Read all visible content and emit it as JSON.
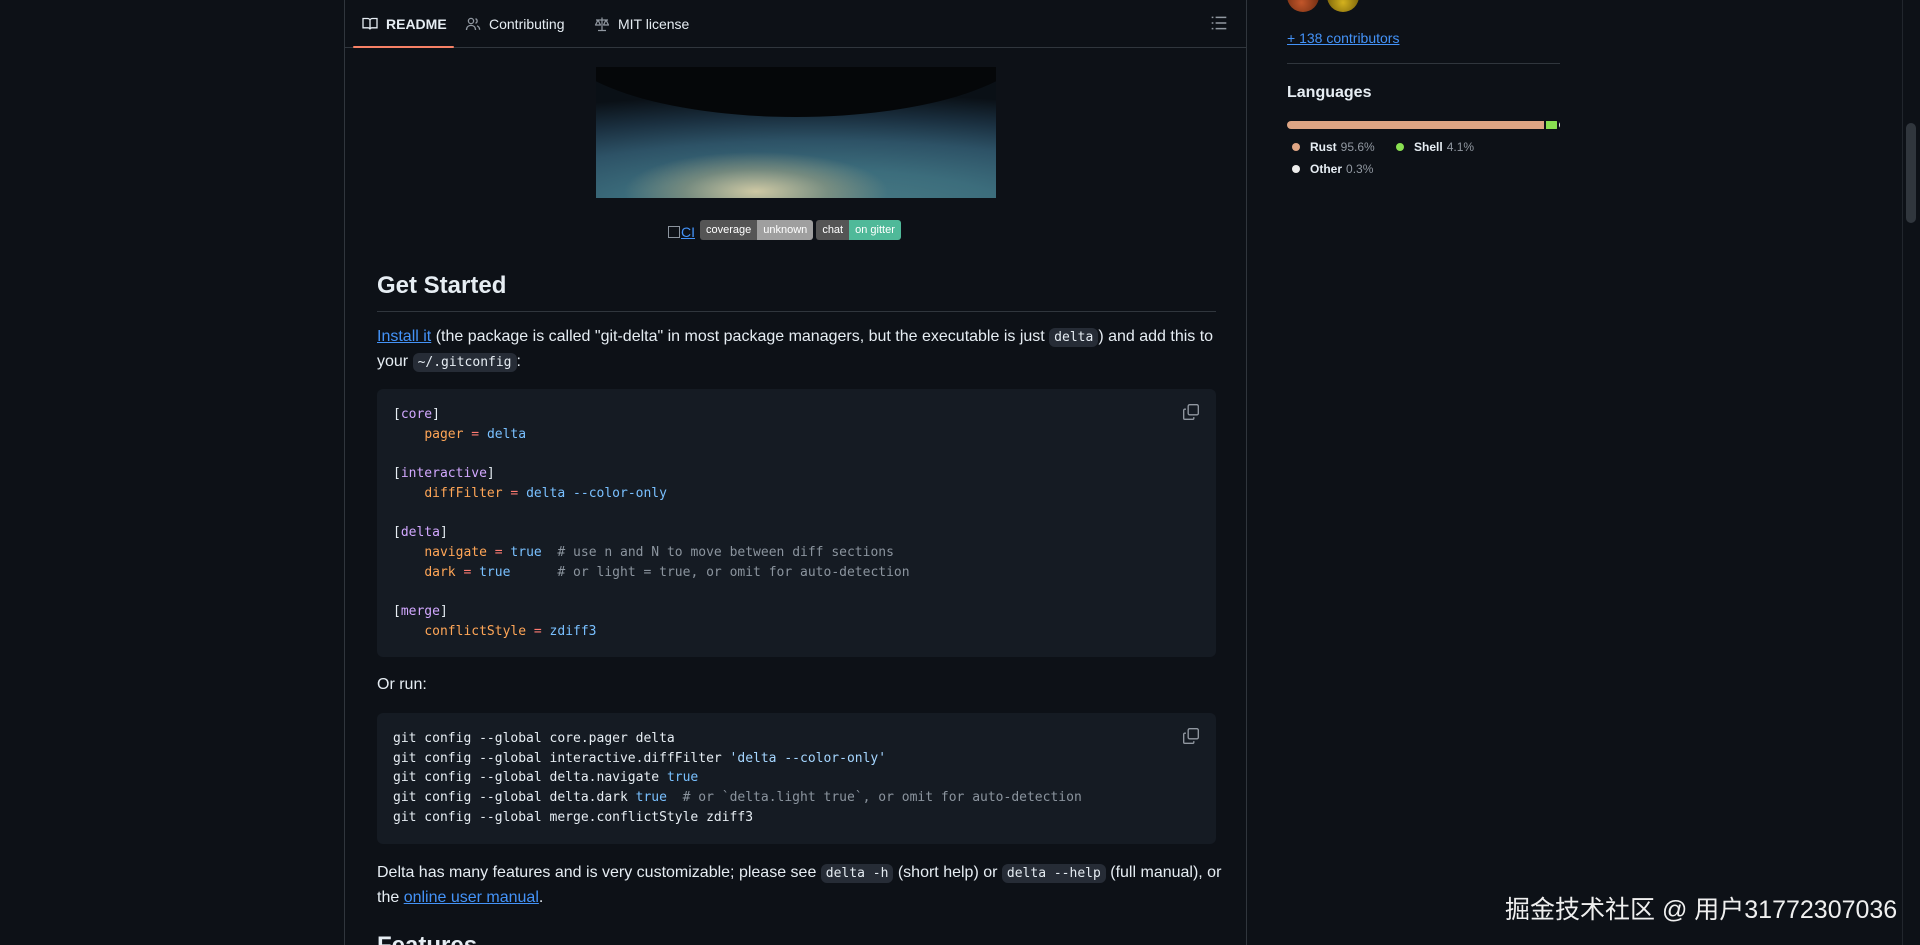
{
  "tabs": [
    {
      "label": "README",
      "icon": "book-icon",
      "active": true
    },
    {
      "label": "Contributing",
      "icon": "people-icon",
      "active": false
    },
    {
      "label": "MIT license",
      "icon": "scale-icon",
      "active": false
    }
  ],
  "badges": {
    "ci_label": "CI",
    "coverage_left": "coverage",
    "coverage_right": "unknown",
    "chat_left": "chat",
    "chat_right": "on gitter"
  },
  "get_started": {
    "heading": "Get Started",
    "p1_link": "Install it",
    "p1_text_a": " (the package is called \"git-delta\" in most package managers, but the executable is just ",
    "p1_code1": "delta",
    "p1_text_b": ") and add this to your ",
    "p1_code2": "~/.gitconfig",
    "p1_text_c": ":",
    "or_run": "Or run:",
    "p3_text_a": "Delta has many features and is very customizable; please see ",
    "p3_code1": "delta -h",
    "p3_text_b": " (short help) or ",
    "p3_code2": "delta --help",
    "p3_text_c": " (full manual), or the ",
    "p3_link": "online user manual",
    "p3_text_d": ".",
    "next_heading": "Features"
  },
  "gitconfig": {
    "core": "core",
    "pager_key": "pager",
    "pager_val": "delta",
    "interactive": "interactive",
    "difffilter_key": "diffFilter",
    "difffilter_val": "delta --color-only",
    "delta": "delta",
    "navigate_key": "navigate",
    "navigate_val": "true",
    "navigate_cm": "# use n and N to move between diff sections",
    "dark_key": "dark",
    "dark_val": "true",
    "dark_cm": "# or light = true, or omit for auto-detection",
    "merge": "merge",
    "conflict_key": "conflictStyle",
    "conflict_val": "zdiff3"
  },
  "commands": {
    "l1": "git config --global core.pager delta",
    "l2_a": "git config --global interactive.diffFilter ",
    "l2_s": "'delta --color-only'",
    "l3_a": "git config --global delta.navigate ",
    "l3_v": "true",
    "l4_a": "git config --global delta.dark ",
    "l4_v": "true",
    "l4_cm": "# or `delta.light true`, or omit for auto-detection",
    "l5": "git config --global merge.conflictStyle zdiff3"
  },
  "sidebar": {
    "contributors_link": "+ 138 contributors",
    "languages_title": "Languages",
    "languages": [
      {
        "name": "Rust",
        "pct": "95.6%",
        "value": 95.6,
        "color": "#dea584"
      },
      {
        "name": "Shell",
        "pct": "4.1%",
        "value": 4.1,
        "color": "#89e051"
      },
      {
        "name": "Other",
        "pct": "0.3%",
        "value": 0.3,
        "color": "#ededed"
      }
    ]
  },
  "watermark": "掘金技术社区 @ 用户31772307036"
}
